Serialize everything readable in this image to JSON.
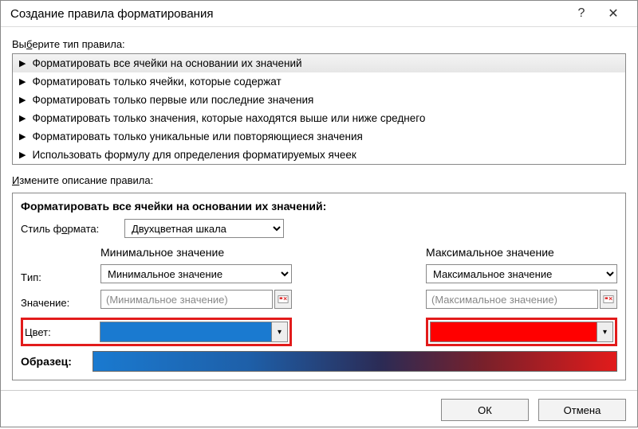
{
  "window": {
    "title": "Создание правила форматирования",
    "help": "?",
    "close": "✕"
  },
  "sections": {
    "select_rule_prefix": "Вы",
    "select_rule_ul": "б",
    "select_rule_suffix": "ерите тип правила:",
    "edit_desc_prefix": "",
    "edit_desc_ul": "И",
    "edit_desc_suffix": "змените описание правила:"
  },
  "rules": [
    "Форматировать все ячейки на основании их значений",
    "Форматировать только ячейки, которые содержат",
    "Форматировать только первые или последние значения",
    "Форматировать только значения, которые находятся выше или ниже среднего",
    "Форматировать только уникальные или повторяющиеся значения",
    "Использовать формулу для определения форматируемых ячеек"
  ],
  "desc": {
    "title": "Форматировать все ячейки на основании их значений:",
    "style_prefix": "Стиль ф",
    "style_ul": "о",
    "style_suffix": "рмата:",
    "style_value": "Двухцветная шкала"
  },
  "min": {
    "header": "Минимальное значение",
    "type_value": "Минимальное значение",
    "value_placeholder": "(Минимальное значение)",
    "color": "#1a7ad0"
  },
  "max": {
    "header": "Максимальное значение",
    "type_value": "Максимальное значение",
    "value_placeholder": "(Максимальное значение)",
    "color": "#ff0000"
  },
  "labels": {
    "type_ul": "Т",
    "type_suffix": "ип:",
    "value_ul": "З",
    "value_suffix": "начение:",
    "color_ul": "Ц",
    "color_suffix": "вет:",
    "sample": "Образец:"
  },
  "footer": {
    "ok": "ОК",
    "cancel": "Отмена"
  }
}
